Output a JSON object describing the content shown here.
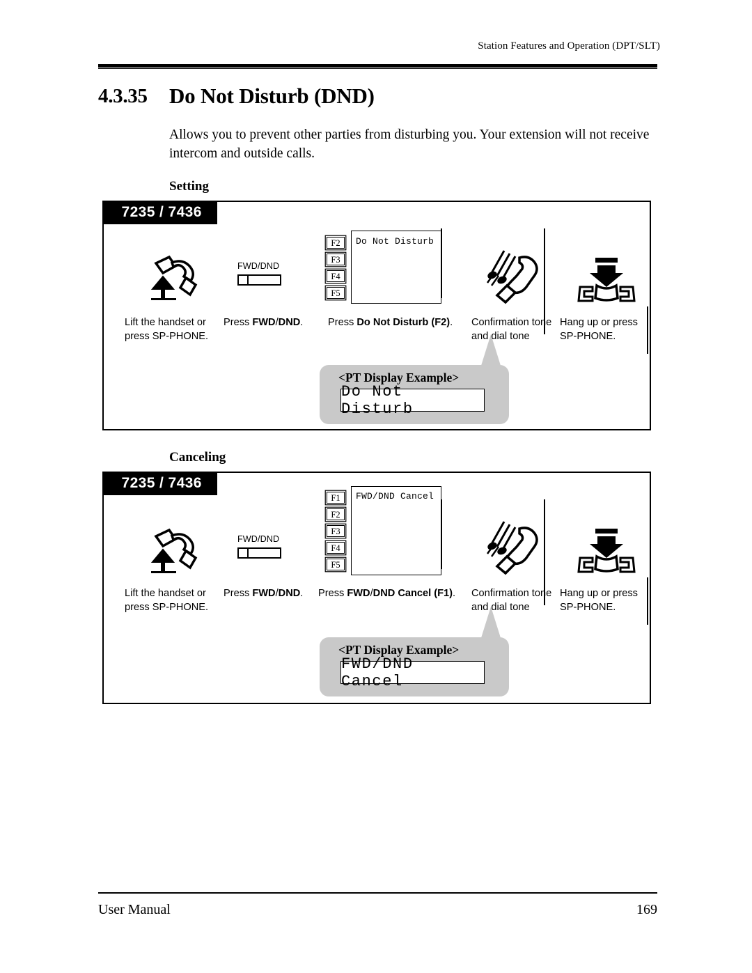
{
  "header": {
    "running_head": "Station Features and Operation (DPT/SLT)"
  },
  "section": {
    "number": "4.3.35",
    "title": "Do Not Disturb (DND)",
    "intro": "Allows you to prevent other parties from disturbing you. Your extension will not receive intercom and outside calls."
  },
  "procedures": [
    {
      "label": "Setting",
      "model_badge": "7235 / 7436",
      "fkeys": [
        "F2",
        "F3",
        "F4",
        "F5"
      ],
      "lcd_line": "Do Not Disturb",
      "dnd_key_label": "FWD/DND",
      "steps": [
        {
          "line1": "Lift the handset or",
          "line2": "press SP-PHONE.",
          "icon": "lift-handset-icon"
        },
        {
          "prefix": "Press ",
          "bold_a": "FWD",
          "slash": "/",
          "bold_b": "DND",
          "suffix": ".",
          "icon": "fwd-dnd-key-icon"
        },
        {
          "prefix": "Press ",
          "bold_a": "Do Not Disturb (F2)",
          "suffix": ".",
          "icon": "lcd-panel-icon"
        },
        {
          "line1": "Confirmation tone",
          "line2": "and dial tone",
          "icon": "ringing-handset-icon"
        },
        {
          "line1": "Hang up or press",
          "line2": "SP-PHONE.",
          "icon": "hang-up-icon"
        }
      ],
      "callout": {
        "title": "<PT Display Example>",
        "display": "Do Not Disturb"
      }
    },
    {
      "label": "Canceling",
      "model_badge": "7235 / 7436",
      "fkeys": [
        "F1",
        "F2",
        "F3",
        "F4",
        "F5"
      ],
      "lcd_line": "FWD/DND Cancel",
      "dnd_key_label": "FWD/DND",
      "steps": [
        {
          "line1": "Lift the handset or",
          "line2": "press SP-PHONE.",
          "icon": "lift-handset-icon"
        },
        {
          "prefix": "Press ",
          "bold_a": "FWD",
          "slash": "/",
          "bold_b": "DND",
          "suffix": ".",
          "icon": "fwd-dnd-key-icon"
        },
        {
          "prefix": "Press ",
          "bold_a": "FWD",
          "slash": "/",
          "bold_b": "DND Cancel (F1)",
          "suffix": ".",
          "icon": "lcd-panel-icon"
        },
        {
          "line1": "Confirmation tone",
          "line2": "and dial tone",
          "icon": "ringing-handset-icon"
        },
        {
          "line1": "Hang up or press",
          "line2": "SP-PHONE.",
          "icon": "hang-up-icon"
        }
      ],
      "callout": {
        "title": "<PT Display Example>",
        "display": "FWD/DND Cancel"
      }
    }
  ],
  "footer": {
    "left": "User Manual",
    "page": "169"
  }
}
